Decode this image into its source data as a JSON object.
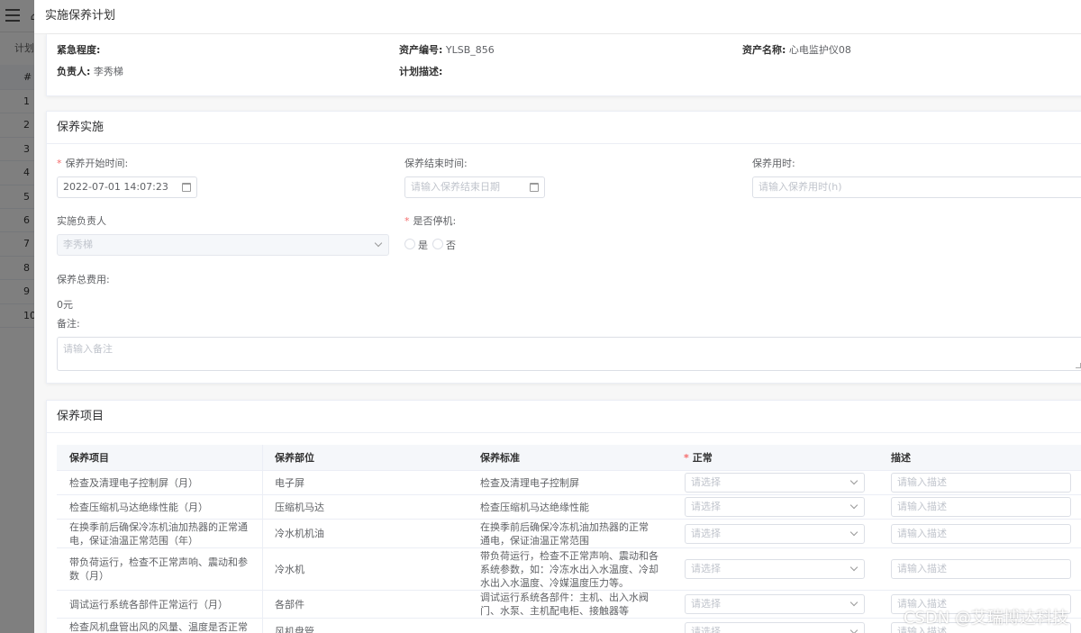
{
  "background": {
    "tab_label": "计划",
    "table_header": "#",
    "row_numbers": [
      "1",
      "2",
      "3",
      "4",
      "5",
      "6",
      "7",
      "8",
      "9",
      "10"
    ]
  },
  "drawer": {
    "title": "实施保养计划"
  },
  "info": {
    "urgency_label": "紧急程度:",
    "urgency_value": "",
    "asset_no_label": "资产编号:",
    "asset_no_value": "YLSB_856",
    "asset_name_label": "资产名称:",
    "asset_name_value": "心电监护仪08",
    "owner_label": "负责人:",
    "owner_value": "李秀梯",
    "plan_desc_label": "计划描述:",
    "plan_desc_value": ""
  },
  "implementation": {
    "section_title": "保养实施",
    "start_time_label": "保养开始时间:",
    "start_time_value": "2022-07-01 14:07:23",
    "end_time_label": "保养结束时间:",
    "end_time_placeholder": "请输入保养结束日期",
    "duration_label": "保养用时:",
    "duration_placeholder": "请输入保养用时(h)",
    "implementer_label": "实施负责人",
    "implementer_value": "李秀梯",
    "shutdown_label": "是否停机:",
    "shutdown_yes": "是",
    "shutdown_no": "否",
    "total_cost_label": "保养总费用:",
    "total_cost_value": "0元",
    "remark_label": "备注:",
    "remark_placeholder": "请输入备注"
  },
  "items": {
    "section_title": "保养项目",
    "columns": [
      "保养项目",
      "保养部位",
      "保养标准",
      "正常",
      "描述"
    ],
    "select_placeholder": "请选择",
    "desc_placeholder": "请输入描述",
    "rows": [
      {
        "item": "检查及清理电子控制屏（月）",
        "part": "电子屏",
        "standard": "检查及清理电子控制屏"
      },
      {
        "item": "检查压缩机马达绝缘性能（月）",
        "part": "压缩机马达",
        "standard": "检查压缩机马达绝缘性能"
      },
      {
        "item": "在换季前后确保冷冻机油加热器的正常通电，保证油温正常范围（年）",
        "part": "冷水机机油",
        "standard": "在换季前后确保冷冻机油加热器的正常通电，保证油温正常范围"
      },
      {
        "item": "带负荷运行，检查不正常声响、震动和参数（月）",
        "part": "冷水机",
        "standard": "带负荷运行，检查不正常声响、震动和各系统参数，如：冷冻水出入水温度、冷却水出入水温度、冷媒温度压力等。"
      },
      {
        "item": "调试运行系统各部件正常运行（月）",
        "part": "各部件",
        "standard": "调试运行系统各部件：主机、出入水阀门、水泵、主机配电柜、接触器等"
      },
      {
        "item": "检查风机盘管出风的风量、温度是否正常(风",
        "part": "风机盘管",
        "standard": ""
      }
    ]
  },
  "watermark": "CSDN @艾瑞博达科技",
  "colors": {
    "required": "#f56c6c",
    "border": "#dcdfe6",
    "overlay": "rgba(0,0,0,0.5)"
  }
}
